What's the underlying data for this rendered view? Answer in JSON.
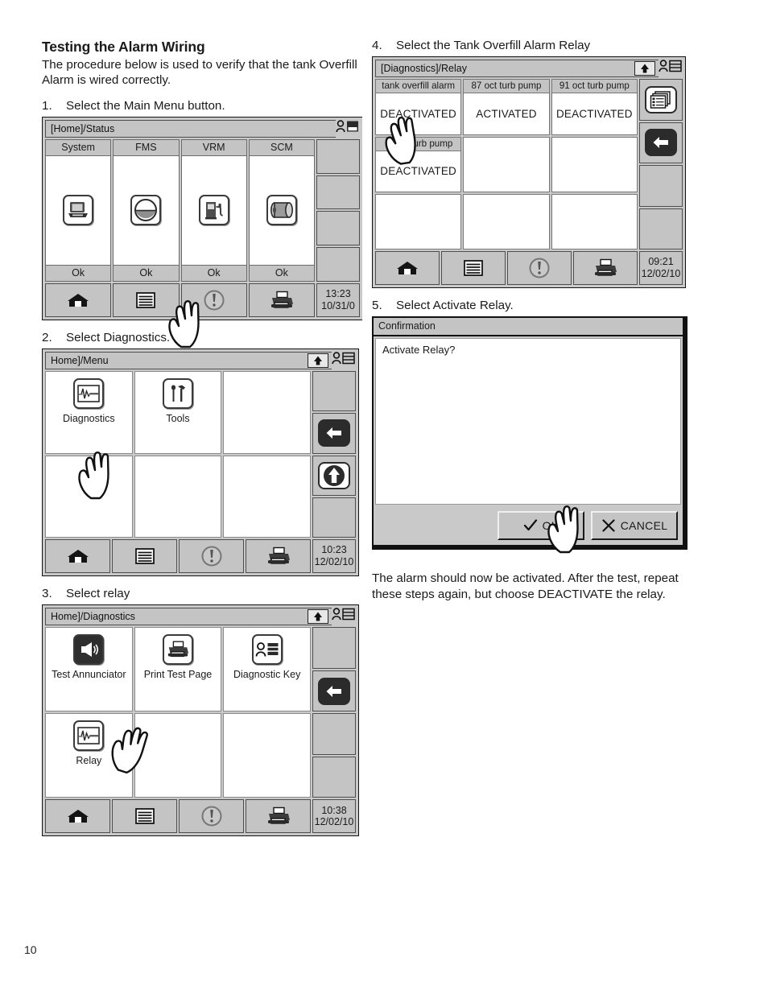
{
  "document": {
    "title": "Testing the Alarm Wiring",
    "intro": "The procedure below is used to verify that the tank Overfill Alarm is wired correctly.",
    "outro": "The alarm should now be activated. After the test, repeat these steps again, but choose DEACTIVATE the relay.",
    "page_number": "10"
  },
  "steps": [
    {
      "num": "1.",
      "text": "Select the Main Menu button."
    },
    {
      "num": "2.",
      "text": "Select Diagnostics."
    },
    {
      "num": "3.",
      "text": "Select relay"
    },
    {
      "num": "4.",
      "text": "Select the Tank Overfill Alarm Relay"
    },
    {
      "num": "5.",
      "text": "Select Activate Relay."
    }
  ],
  "screen_status": {
    "title": "[Home]/Status",
    "id_icon": "user-list-icon",
    "columns": [
      {
        "header": "System",
        "icon": "console-icon",
        "status": "Ok"
      },
      {
        "header": "FMS",
        "icon": "tank-level-icon",
        "status": "Ok"
      },
      {
        "header": "VRM",
        "icon": "fuel-pump-icon",
        "status": "Ok"
      },
      {
        "header": "SCM",
        "icon": "cylinder-icon",
        "status": "Ok"
      }
    ],
    "toolbar": [
      {
        "icon": "home-icon"
      },
      {
        "icon": "menu-icon"
      },
      {
        "icon": "alarm-icon"
      },
      {
        "icon": "printer-icon"
      }
    ],
    "clock": {
      "time": "13:23",
      "date": "10/31/0"
    }
  },
  "screen_menu": {
    "title": "Home]/Menu",
    "title_badge_icon": "up-arrow-badge-icon",
    "id_icon": "user-list-icon",
    "cells": [
      {
        "label": "Diagnostics",
        "icon": "waveform-icon"
      },
      {
        "label": "Tools",
        "icon": "tools-icon"
      },
      {
        "label": "",
        "icon": ""
      },
      {
        "label": "",
        "icon": ""
      },
      {
        "label": "",
        "icon": ""
      },
      {
        "label": "",
        "icon": ""
      }
    ],
    "side_buttons": [
      {
        "icon": ""
      },
      {
        "icon": "back-arrow-icon"
      },
      {
        "icon": "up-arrow-icon"
      },
      {
        "icon": ""
      }
    ],
    "toolbar": [
      {
        "icon": "home-icon"
      },
      {
        "icon": "menu-icon"
      },
      {
        "icon": "alarm-icon"
      },
      {
        "icon": "printer-icon"
      }
    ],
    "clock": {
      "time": "10:23",
      "date": "12/02/10"
    }
  },
  "screen_diagnostics": {
    "title": "Home]/Diagnostics",
    "title_badge_icon": "up-arrow-badge-icon",
    "id_icon": "user-list-icon",
    "cells": [
      {
        "label": "Test Annunciator",
        "icon": "speaker-icon"
      },
      {
        "label": "Print Test Page",
        "icon": "printer-icon"
      },
      {
        "label": "Diagnostic Key",
        "icon": "user-list-icon"
      },
      {
        "label": "Relay",
        "icon": "waveform-icon"
      },
      {
        "label": "",
        "icon": ""
      },
      {
        "label": "",
        "icon": ""
      }
    ],
    "side_buttons": [
      {
        "icon": ""
      },
      {
        "icon": "back-arrow-icon"
      },
      {
        "icon": ""
      },
      {
        "icon": ""
      }
    ],
    "toolbar": [
      {
        "icon": "home-icon"
      },
      {
        "icon": "menu-icon"
      },
      {
        "icon": "alarm-icon"
      },
      {
        "icon": "printer-icon"
      }
    ],
    "clock": {
      "time": "10:38",
      "date": "12/02/10"
    }
  },
  "screen_relay": {
    "title": "[Diagnostics]/Relay",
    "title_badge_icon": "up-arrow-badge-icon",
    "id_icon": "user-list-icon",
    "cells": [
      {
        "header": "tank overfill alarm",
        "value": "DEACTIVATED"
      },
      {
        "header": "87 oct  turb pump",
        "value": "ACTIVATED"
      },
      {
        "header": "91 oct turb pump",
        "value": "DEACTIVATED"
      },
      {
        "header": "urb pump",
        "value": "DEACTIVATED"
      },
      {
        "header": "",
        "value": ""
      },
      {
        "header": "",
        "value": ""
      },
      {
        "header": "",
        "value": ""
      },
      {
        "header": "",
        "value": ""
      },
      {
        "header": "",
        "value": ""
      }
    ],
    "side_buttons": [
      {
        "icon": "stacked-list-icon"
      },
      {
        "icon": "back-arrow-icon"
      },
      {
        "icon": ""
      },
      {
        "icon": ""
      }
    ],
    "toolbar": [
      {
        "icon": "home-icon"
      },
      {
        "icon": "menu-icon"
      },
      {
        "icon": "alarm-icon"
      },
      {
        "icon": "printer-icon"
      }
    ],
    "clock": {
      "time": "09:21",
      "date": "12/02/10"
    }
  },
  "dialog_confirmation": {
    "title": "Confirmation",
    "message": "Activate Relay?",
    "ok_label": "OK",
    "cancel_label": "CANCEL",
    "ok_icon": "check-icon",
    "cancel_icon": "x-icon"
  }
}
